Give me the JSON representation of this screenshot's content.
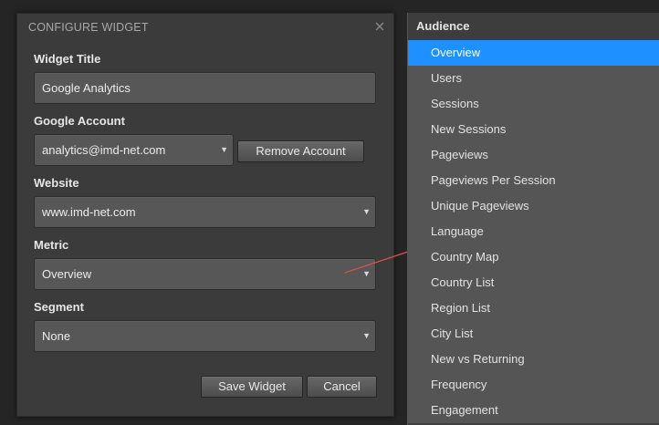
{
  "dialog": {
    "title": "CONFIGURE WIDGET",
    "close_icon": "close-icon",
    "widget_title": {
      "label": "Widget Title",
      "value": "Google Analytics"
    },
    "google_account": {
      "label": "Google Account",
      "value": "analytics@imd-net.com",
      "remove_label": "Remove Account"
    },
    "website": {
      "label": "Website",
      "value": "www.imd-net.com"
    },
    "metric": {
      "label": "Metric",
      "value": "Overview"
    },
    "segment": {
      "label": "Segment",
      "value": "None"
    },
    "save_label": "Save Widget",
    "cancel_label": "Cancel"
  },
  "dropdown": {
    "group_label": "Audience",
    "selected_index": 0,
    "items": [
      "Overview",
      "Users",
      "Sessions",
      "New Sessions",
      "Pageviews",
      "Pageviews Per Session",
      "Unique Pageviews",
      "Language",
      "Country Map",
      "Country List",
      "Region List",
      "City List",
      "New vs Returning",
      "Frequency",
      "Engagement"
    ]
  },
  "colors": {
    "accent": "#1e90ff",
    "connector": "#d9534f"
  },
  "icons": {
    "select_caret": "caret-down-icon"
  }
}
